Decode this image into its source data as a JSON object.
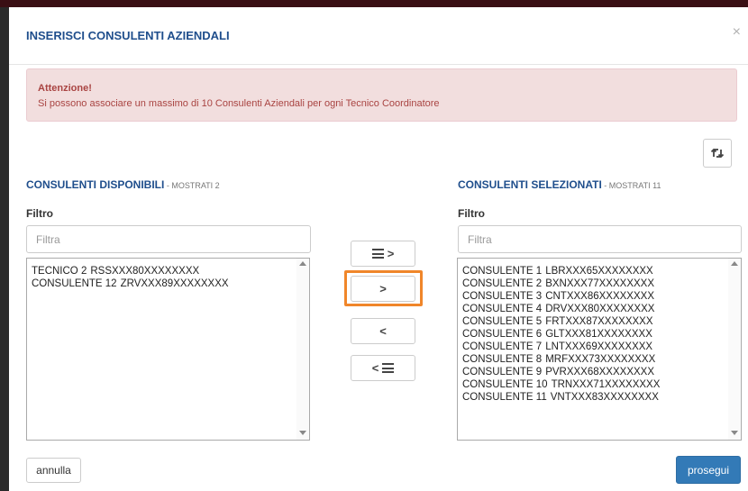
{
  "modal": {
    "title": "INSERISCI CONSULENTI AZIENDALI",
    "close_symbol": "×"
  },
  "alert": {
    "title": "Attenzione!",
    "text": "Si possono associare un massimo di 10 Consulenti Aziendali per ogni Tecnico Coordinatore"
  },
  "available": {
    "title": "CONSULENTI DISPONIBILI",
    "count_label": " - MOSTRATI 2",
    "filter_label": "Filtro",
    "filter_placeholder": "Filtra",
    "items": [
      {
        "name": "TECNICO 2",
        "code": "RSSXXX80XXXXXXXX"
      },
      {
        "name": "CONSULENTE 12",
        "code": "ZRVXXX89XXXXXXXX"
      }
    ]
  },
  "selected": {
    "title": "CONSULENTI SELEZIONATI",
    "count_label": " - MOSTRATI 11",
    "filter_label": "Filtro",
    "filter_placeholder": "Filtra",
    "items": [
      {
        "name": "CONSULENTE 1",
        "code": "LBRXXX65XXXXXXXX"
      },
      {
        "name": "CONSULENTE 2",
        "code": "BXNXXX77XXXXXXXX"
      },
      {
        "name": "CONSULENTE 3",
        "code": "CNTXXX86XXXXXXXX"
      },
      {
        "name": "CONSULENTE 4",
        "code": "DRVXXX80XXXXXXXX"
      },
      {
        "name": "CONSULENTE 5",
        "code": "FRTXXX87XXXXXXXX"
      },
      {
        "name": "CONSULENTE 6",
        "code": "GLTXXX81XXXXXXXX"
      },
      {
        "name": "CONSULENTE 7",
        "code": "LNTXXX69XXXXXXXX"
      },
      {
        "name": "CONSULENTE 8",
        "code": "MRFXXX73XXXXXXXX"
      },
      {
        "name": "CONSULENTE 9",
        "code": "PVRXXX68XXXXXXXX"
      },
      {
        "name": "CONSULENTE 10",
        "code": "TRNXXX71XXXXXXXX"
      },
      {
        "name": "CONSULENTE 11",
        "code": "VNTXXX83XXXXXXXX"
      }
    ]
  },
  "transfer": {
    "move_all_right_label": ">",
    "move_right_label": ">",
    "move_left_label": "<",
    "move_all_left_label": "<"
  },
  "swap_icon": "⇆",
  "footer": {
    "cancel_label": "annulla",
    "proceed_label": "prosegui"
  },
  "colors": {
    "title_blue": "#1f4e8c",
    "alert_bg": "#f2dede",
    "alert_text": "#a94442",
    "primary_button": "#337ab7",
    "highlight_orange": "#f0862a"
  }
}
